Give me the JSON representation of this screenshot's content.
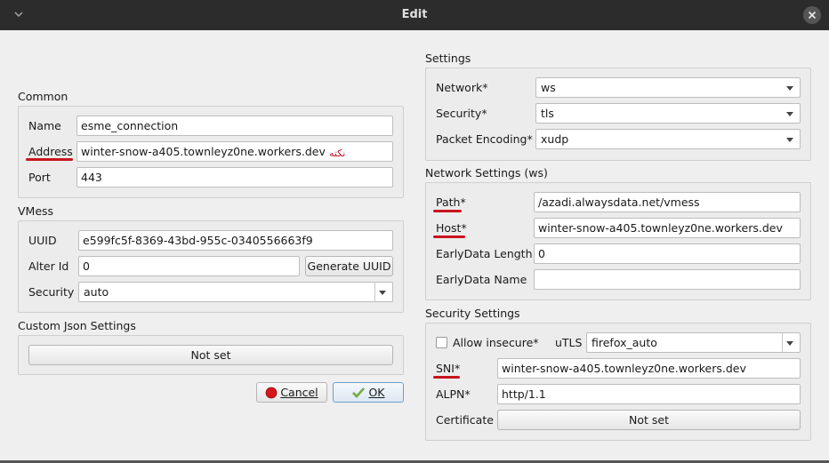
{
  "window": {
    "title": "Edit"
  },
  "common": {
    "title": "Common",
    "name_label": "Name",
    "name_value": "esme_connection",
    "address_label": "Address",
    "address_value": "winter-snow-a405.townleyz0ne.workers.dev",
    "address_note": "نکته",
    "port_label": "Port",
    "port_value": "443"
  },
  "vmess": {
    "title": "VMess",
    "uuid_label": "UUID",
    "uuid_value": "e599fc5f-8369-43bd-955c-0340556663f9",
    "alterid_label": "Alter Id",
    "alterid_value": "0",
    "generate_label": "Generate UUID",
    "security_label": "Security",
    "security_value": "auto"
  },
  "custom_json": {
    "title": "Custom Json Settings",
    "button_label": "Not set"
  },
  "dialog_buttons": {
    "cancel_label": "Cancel",
    "ok_label": "OK"
  },
  "settings": {
    "title": "Settings",
    "network_label": "Network*",
    "network_value": "ws",
    "security_label": "Security*",
    "security_value": "tls",
    "packet_label": "Packet Encoding*",
    "packet_value": "xudp"
  },
  "network_settings": {
    "title": "Network Settings (ws)",
    "path_label": "Path*",
    "path_value": "/azadi.alwaysdata.net/vmess",
    "host_label": "Host*",
    "host_value": "winter-snow-a405.townleyz0ne.workers.dev",
    "early_len_label": "EarlyData Length",
    "early_len_value": "0",
    "early_name_label": "EarlyData Name",
    "early_name_value": ""
  },
  "security_settings": {
    "title": "Security Settings",
    "allow_insecure_label": "Allow insecure*",
    "allow_insecure_checked": false,
    "utls_label": "uTLS",
    "utls_value": "firefox_auto",
    "sni_label": "SNI*",
    "sni_value": "winter-snow-a405.townleyz0ne.workers.dev",
    "alpn_label": "ALPN*",
    "alpn_value": "http/1.1",
    "cert_label": "Certificate",
    "cert_button_label": "Not set"
  },
  "colors": {
    "titlebar": "#2c2c2c",
    "client": "#efefef",
    "annotation": "#c8141c"
  },
  "icons": [
    "chevron-down-icon",
    "close-icon",
    "cancel-icon",
    "ok-icon"
  ]
}
